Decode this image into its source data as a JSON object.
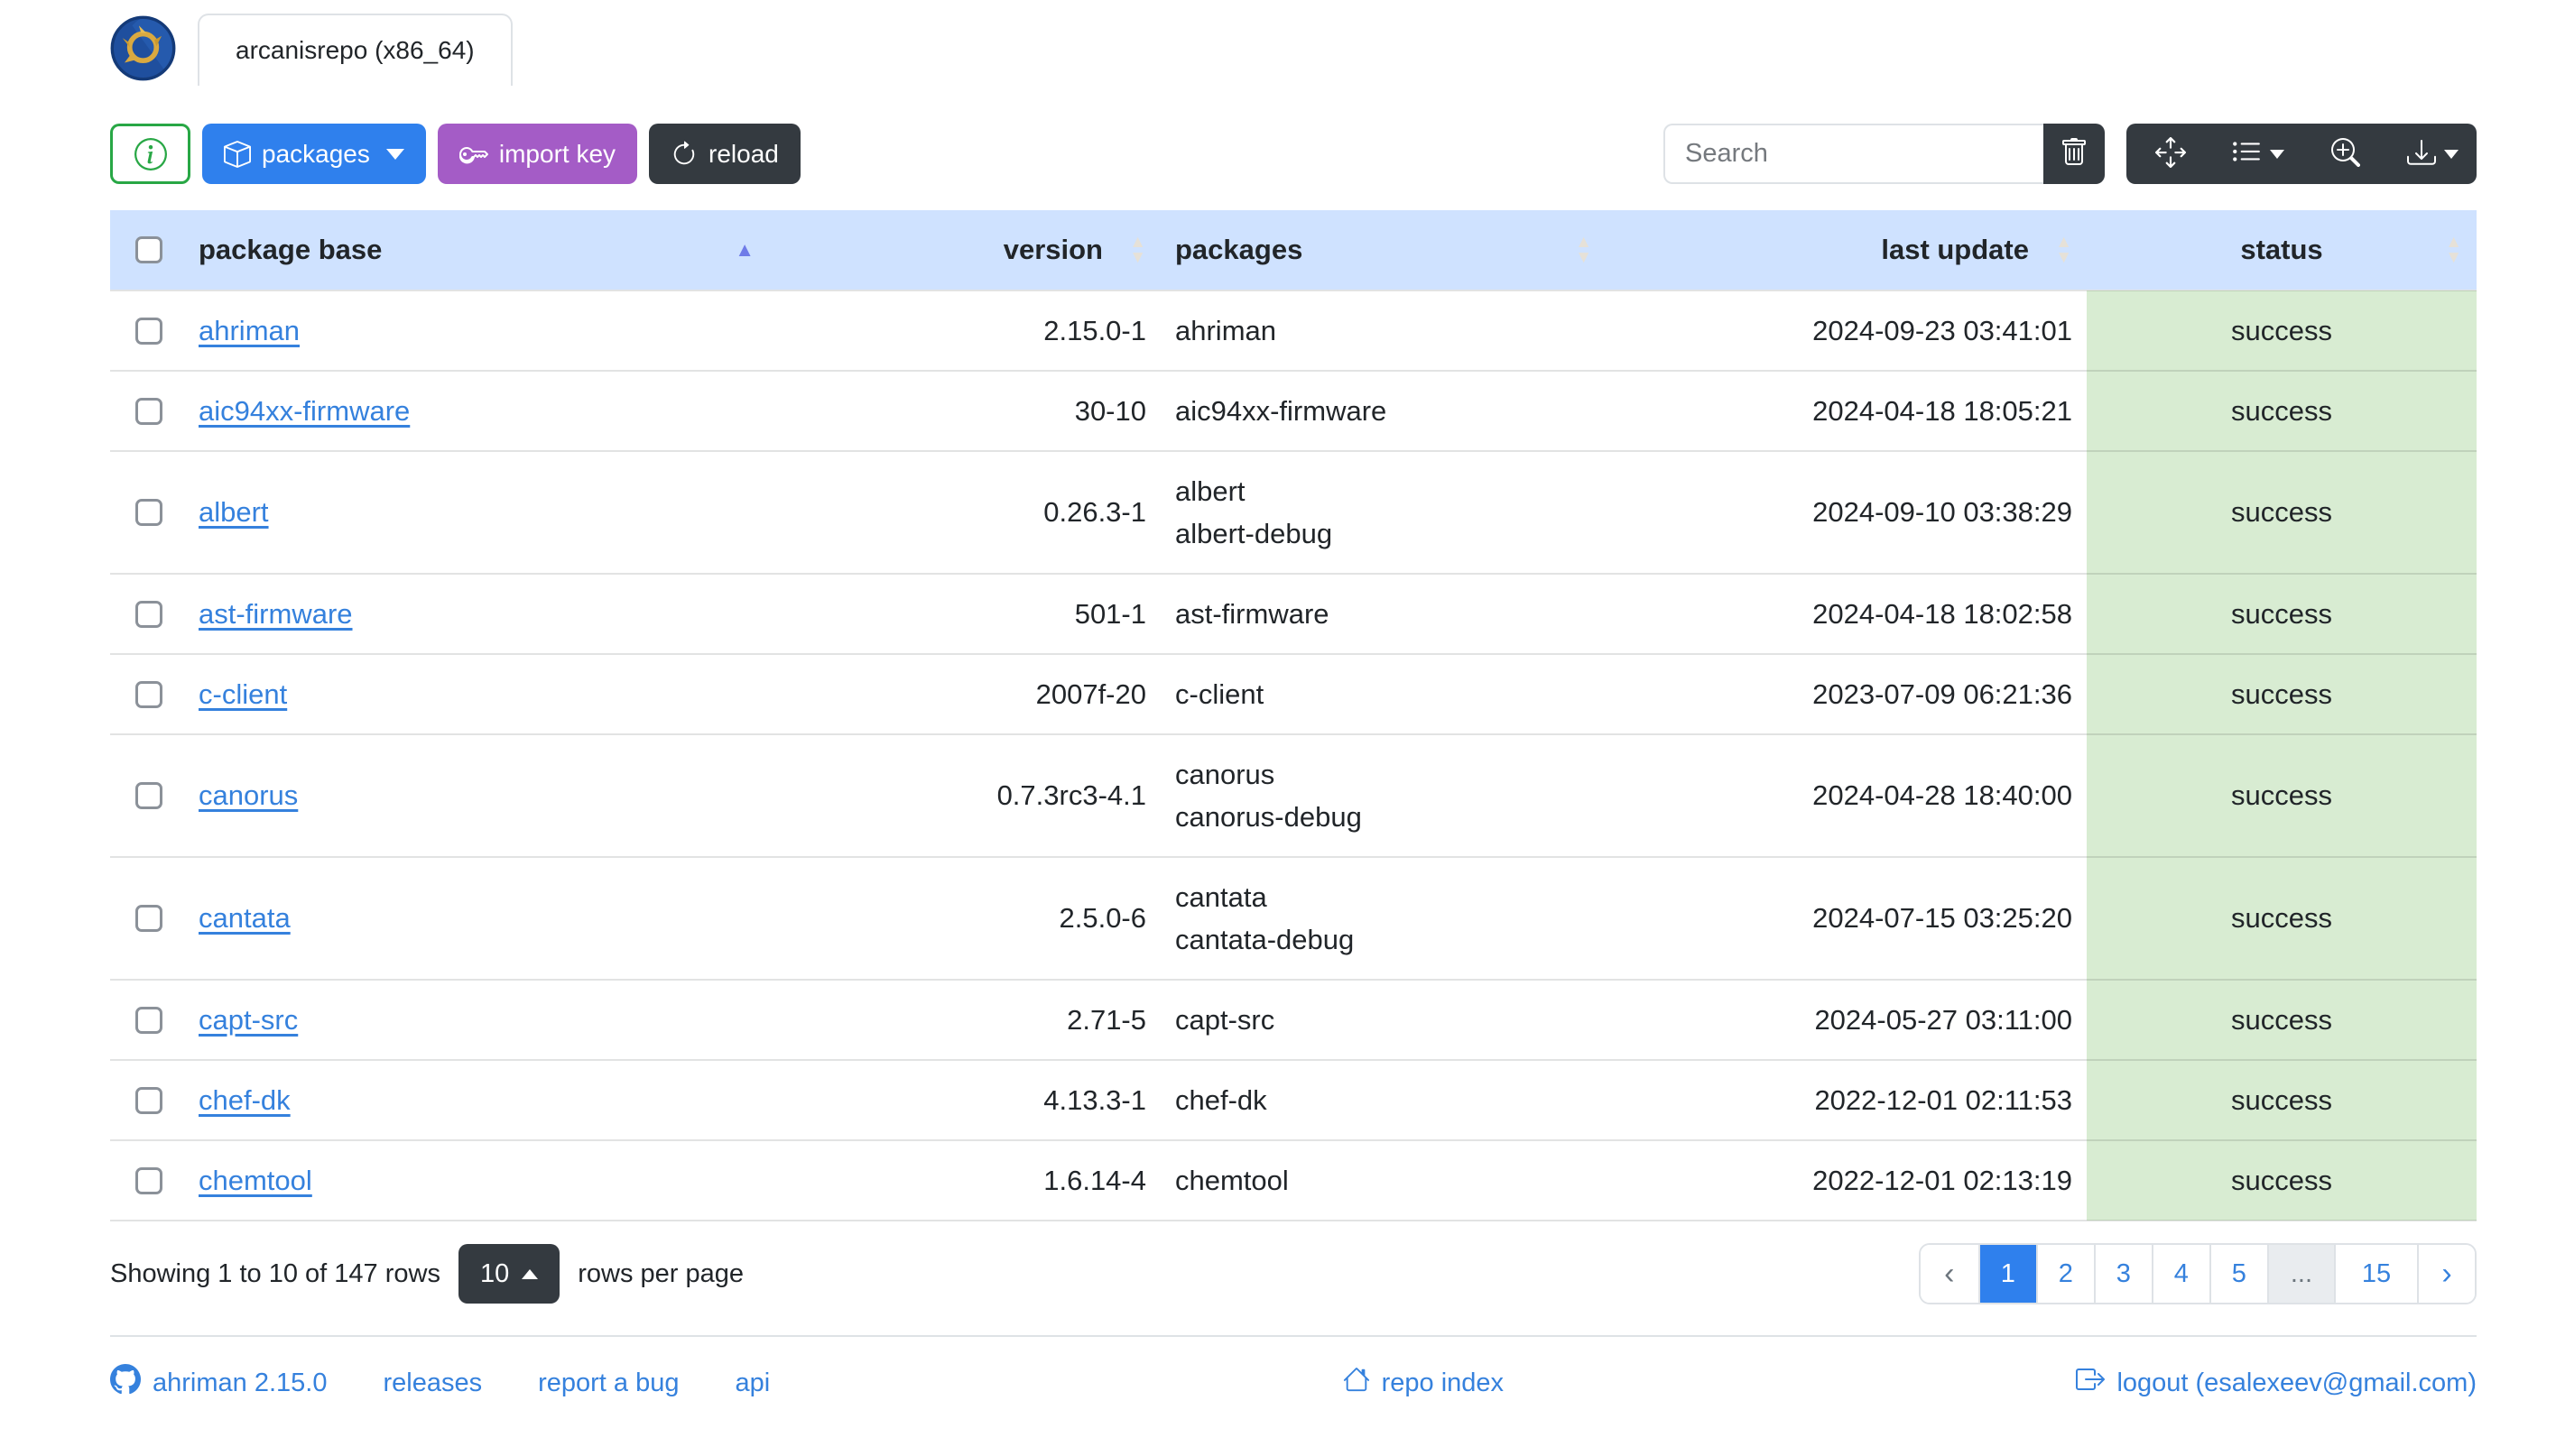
{
  "header": {
    "tab_label": "arcanisrepo (x86_64)"
  },
  "toolbar": {
    "packages_label": "packages",
    "import_key_label": "import key",
    "reload_label": "reload",
    "search_placeholder": "Search",
    "icons": {
      "info": "info-circle-icon",
      "packages": "box-icon",
      "import_key": "key-icon",
      "reload": "arrow-clockwise-icon",
      "clear": "trash-icon",
      "fullscreen": "arrows-move-icon",
      "columns": "list-icon",
      "zoom": "zoom-in-icon",
      "export": "download-icon"
    }
  },
  "colors": {
    "primary": "#2f80ed",
    "purple": "#a45cc6",
    "dark": "#343a40",
    "info_green": "#28a745",
    "header_bg": "#cfe2ff",
    "success_bg": "#d8ecd2",
    "link": "#3581dd",
    "sort_active": "#6f7be8"
  },
  "table": {
    "columns": [
      {
        "label": "package base",
        "sortable": true,
        "sort": "asc",
        "align": "left"
      },
      {
        "label": "version",
        "sortable": true,
        "sort": null,
        "align": "right"
      },
      {
        "label": "packages",
        "sortable": true,
        "sort": null,
        "align": "left"
      },
      {
        "label": "last update",
        "sortable": true,
        "sort": null,
        "align": "right"
      },
      {
        "label": "status",
        "sortable": true,
        "sort": null,
        "align": "center"
      }
    ],
    "rows": [
      {
        "base": "ahriman",
        "version": "2.15.0-1",
        "packages": [
          "ahriman"
        ],
        "last_update": "2024-09-23 03:41:01",
        "status": "success"
      },
      {
        "base": "aic94xx-firmware",
        "version": "30-10",
        "packages": [
          "aic94xx-firmware"
        ],
        "last_update": "2024-04-18 18:05:21",
        "status": "success"
      },
      {
        "base": "albert",
        "version": "0.26.3-1",
        "packages": [
          "albert",
          "albert-debug"
        ],
        "last_update": "2024-09-10 03:38:29",
        "status": "success"
      },
      {
        "base": "ast-firmware",
        "version": "501-1",
        "packages": [
          "ast-firmware"
        ],
        "last_update": "2024-04-18 18:02:58",
        "status": "success"
      },
      {
        "base": "c-client",
        "version": "2007f-20",
        "packages": [
          "c-client"
        ],
        "last_update": "2023-07-09 06:21:36",
        "status": "success"
      },
      {
        "base": "canorus",
        "version": "0.7.3rc3-4.1",
        "packages": [
          "canorus",
          "canorus-debug"
        ],
        "last_update": "2024-04-28 18:40:00",
        "status": "success"
      },
      {
        "base": "cantata",
        "version": "2.5.0-6",
        "packages": [
          "cantata",
          "cantata-debug"
        ],
        "last_update": "2024-07-15 03:25:20",
        "status": "success"
      },
      {
        "base": "capt-src",
        "version": "2.71-5",
        "packages": [
          "capt-src"
        ],
        "last_update": "2024-05-27 03:11:00",
        "status": "success"
      },
      {
        "base": "chef-dk",
        "version": "4.13.3-1",
        "packages": [
          "chef-dk"
        ],
        "last_update": "2022-12-01 02:11:53",
        "status": "success"
      },
      {
        "base": "chemtool",
        "version": "1.6.14-4",
        "packages": [
          "chemtool"
        ],
        "last_update": "2022-12-01 02:13:19",
        "status": "success"
      }
    ]
  },
  "pagination": {
    "summary": "Showing 1 to 10 of 147 rows",
    "page_size": "10",
    "per_page_label": "rows per page",
    "items": [
      {
        "label": "‹",
        "type": "prev"
      },
      {
        "label": "1",
        "type": "page",
        "active": true
      },
      {
        "label": "2",
        "type": "page"
      },
      {
        "label": "3",
        "type": "page"
      },
      {
        "label": "4",
        "type": "page"
      },
      {
        "label": "5",
        "type": "page"
      },
      {
        "label": "...",
        "type": "ellipsis"
      },
      {
        "label": "15",
        "type": "page"
      },
      {
        "label": "›",
        "type": "next"
      }
    ]
  },
  "footer": {
    "version_link": "ahriman 2.15.0",
    "releases_link": "releases",
    "bug_link": "report a bug",
    "api_link": "api",
    "repo_index_link": "repo index",
    "logout_link": "logout (esalexeev@gmail.com)"
  }
}
